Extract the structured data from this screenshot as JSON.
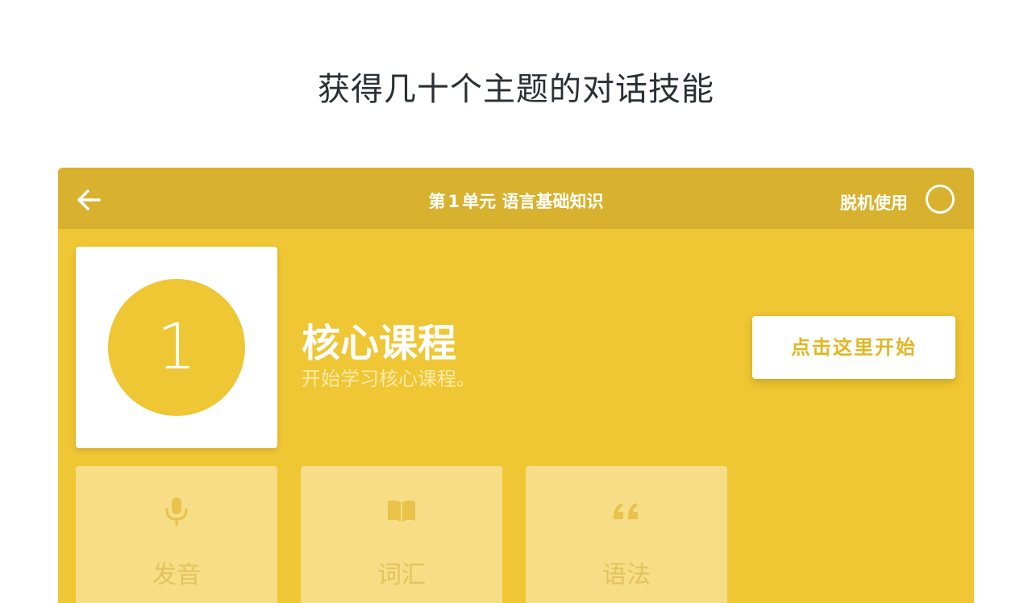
{
  "headline": "获得几十个主题的对话技能",
  "topbar": {
    "unit_prefix": "第",
    "unit_number": "1",
    "unit_suffix": "单元 语言基础知识",
    "offline_label": "脱机使用"
  },
  "lesson": {
    "number": "1",
    "title": "核心课程",
    "subtitle": "开始学习核心课程。",
    "start_label": "点击这里开始"
  },
  "tiles": [
    {
      "label": "发音",
      "icon": "microphone-icon"
    },
    {
      "label": "词汇",
      "icon": "book-icon"
    },
    {
      "label": "语法",
      "icon": "quote-icon"
    }
  ],
  "colors": {
    "accent": "#efc633",
    "topbar": "#d8b12e",
    "tile": "#f6dd86",
    "start_text": "#e2b623"
  }
}
